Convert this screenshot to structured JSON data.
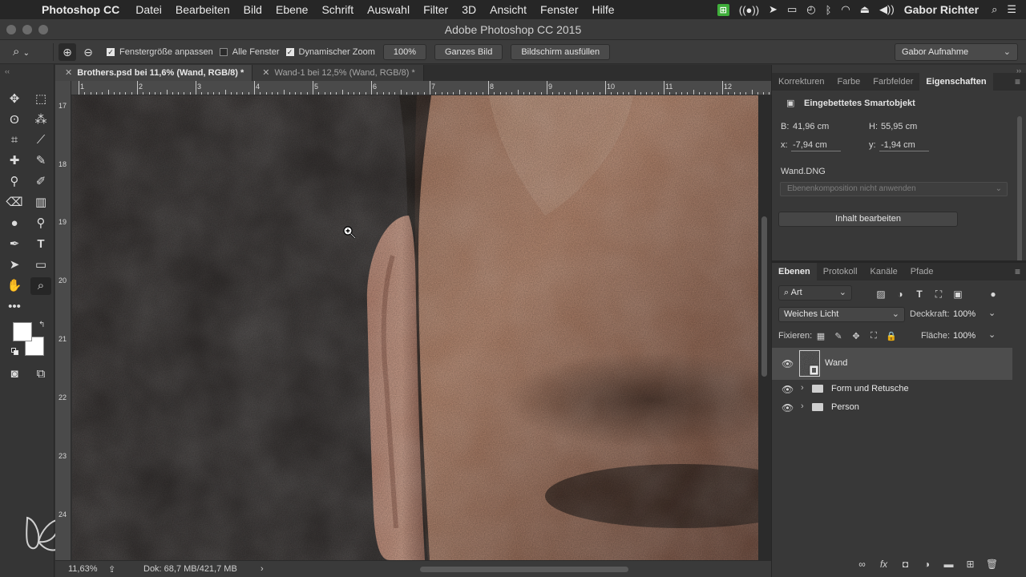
{
  "menubar": {
    "apple_icon": "apple-logo-icon",
    "items": [
      "Photoshop CC",
      "Datei",
      "Bearbeiten",
      "Bild",
      "Ebene",
      "Schrift",
      "Auswahl",
      "Filter",
      "3D",
      "Ansicht",
      "Fenster",
      "Hilfe"
    ],
    "status_icons": [
      "evernote-icon",
      "wifi-hotspot-icon",
      "link-icon",
      "display-icon",
      "time-machine-icon",
      "bluetooth-icon",
      "wifi-icon",
      "eject-icon",
      "volume-icon"
    ],
    "status_green_label": "⊞",
    "user": "Gabor Richter",
    "spotlight_icon": "search-icon",
    "notification_icon": "list-icon"
  },
  "window": {
    "title": "Adobe Photoshop CC 2015"
  },
  "options": {
    "fit_window_label": "Fenstergröße anpassen",
    "fit_window_checked": true,
    "all_windows_label": "Alle Fenster",
    "all_windows_checked": false,
    "scrubby_zoom_label": "Dynamischer Zoom",
    "scrubby_zoom_checked": true,
    "btn_100": "100%",
    "btn_fit": "Ganzes Bild",
    "btn_fill": "Bildschirm ausfüllen",
    "workspace": "Gabor Aufnahme"
  },
  "tabs": [
    {
      "label": "Brothers.psd bei 11,6% (Wand, RGB/8) *",
      "active": true
    },
    {
      "label": "Wand-1 bei 12,5% (Wand, RGB/8) *",
      "active": false
    }
  ],
  "ruler": {
    "top_numbers": [
      "1",
      "2",
      "3",
      "4",
      "5",
      "6",
      "7",
      "8",
      "9",
      "10",
      "11",
      "12"
    ],
    "left_numbers": [
      "17",
      "18",
      "19",
      "20",
      "21",
      "22",
      "23",
      "24"
    ]
  },
  "statusbar": {
    "zoom": "11,63%",
    "doc": "Dok: 68,7 MB/421,7 MB",
    "arrow": "›"
  },
  "properties": {
    "tabs": [
      "Korrekturen",
      "Farbe",
      "Farbfelder",
      "Eigenschaften"
    ],
    "active_tab": "Eigenschaften",
    "header": "Eingebettetes Smartobjekt",
    "w_label": "B:",
    "w_value": "41,96 cm",
    "h_label": "H:",
    "h_value": "55,95 cm",
    "x_label": "x:",
    "x_value": "-7,94 cm",
    "y_label": "y:",
    "y_value": "-1,94 cm",
    "file": "Wand.DNG",
    "comp_select": "Ebenenkomposition nicht anwenden",
    "edit_button": "Inhalt bearbeiten"
  },
  "layers": {
    "tabs": [
      "Ebenen",
      "Protokoll",
      "Kanäle",
      "Pfade"
    ],
    "active_tab": "Ebenen",
    "filter_label": "Art",
    "blend_mode": "Weiches Licht",
    "opacity_label": "Deckkraft:",
    "opacity_value": "100%",
    "lock_label": "Fixieren:",
    "fill_label": "Fläche:",
    "fill_value": "100%",
    "items": [
      {
        "name": "Wand",
        "type": "smart-object",
        "visible": true,
        "selected": true
      },
      {
        "name": "Form und Retusche",
        "type": "group",
        "visible": true,
        "selected": false
      },
      {
        "name": "Person",
        "type": "group",
        "visible": true,
        "selected": false
      }
    ],
    "bottom_fx": "fx"
  },
  "colors": {
    "foreground": "#ffffff",
    "background": "#ffffff",
    "panel_bg": "#383838",
    "selected_layer": "#4d4d4d"
  }
}
